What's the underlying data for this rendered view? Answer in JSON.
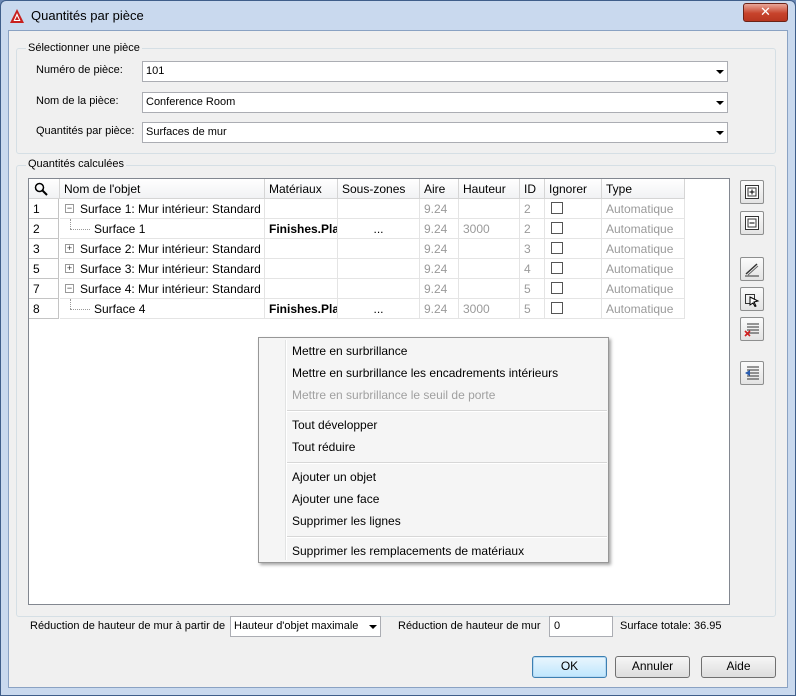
{
  "window": {
    "title": "Quantités par pièce",
    "close_glyph": "✕"
  },
  "select_group": {
    "legend": "Sélectionner une pièce",
    "room_number_label": "Numéro de pièce:",
    "room_number_value": "101",
    "room_name_label": "Nom de la pièce:",
    "room_name_value": "Conference Room",
    "quantities_label": "Quantités par pièce:",
    "quantities_value": "Surfaces de mur"
  },
  "calc_group": {
    "legend": "Quantités calculées",
    "columns": [
      "Nom de l'objet",
      "Matériaux",
      "Sous-zones",
      "Aire",
      "Hauteur",
      "ID",
      "Ignorer",
      "Type"
    ],
    "rows": [
      {
        "num": "1",
        "name": "Surface 1: Mur intérieur: Standard",
        "material": "",
        "subzones": "",
        "area": "9.24",
        "height": "",
        "id": "2",
        "type": "Automatique",
        "level": 0,
        "toggle": "−"
      },
      {
        "num": "2",
        "name": "Surface 1",
        "material": "Finishes.Plas",
        "subzones": "...",
        "area": "9.24",
        "height": "3000",
        "id": "2",
        "type": "Automatique",
        "level": 1,
        "toggle": ""
      },
      {
        "num": "3",
        "name": "Surface 2: Mur intérieur: Standard",
        "material": "",
        "subzones": "",
        "area": "9.24",
        "height": "",
        "id": "3",
        "type": "Automatique",
        "level": 0,
        "toggle": "+"
      },
      {
        "num": "5",
        "name": "Surface 3: Mur intérieur: Standard",
        "material": "",
        "subzones": "",
        "area": "9.24",
        "height": "",
        "id": "4",
        "type": "Automatique",
        "level": 0,
        "toggle": "+"
      },
      {
        "num": "7",
        "name": "Surface 4: Mur intérieur: Standard",
        "material": "",
        "subzones": "",
        "area": "9.24",
        "height": "",
        "id": "5",
        "type": "Automatique",
        "level": 0,
        "toggle": "−"
      },
      {
        "num": "8",
        "name": "Surface 4",
        "material": "Finishes.Plas",
        "subzones": "...",
        "area": "9.24",
        "height": "3000",
        "id": "5",
        "type": "Automatique",
        "level": 1,
        "toggle": ""
      }
    ]
  },
  "context_menu": {
    "items": [
      {
        "label": "Mettre en surbrillance",
        "disabled": false
      },
      {
        "label": "Mettre en surbrillance les encadrements intérieurs",
        "disabled": false
      },
      {
        "label": "Mettre en surbrillance le seuil de porte",
        "disabled": true
      },
      {
        "label": "Tout développer",
        "disabled": false
      },
      {
        "label": "Tout réduire",
        "disabled": false
      },
      {
        "label": "Ajouter un objet",
        "disabled": false
      },
      {
        "label": "Ajouter une face",
        "disabled": false
      },
      {
        "label": "Supprimer les lignes",
        "disabled": false
      },
      {
        "label": "Supprimer les remplacements de matériaux",
        "disabled": false
      }
    ]
  },
  "bottom": {
    "reduction_from_label": "Réduction de hauteur de mur à partir de",
    "reduction_from_value": "Hauteur d'objet maximale",
    "reduction_label": "Réduction de hauteur de mur",
    "reduction_value": "0",
    "total_surface": "Surface totale: 36.95"
  },
  "buttons": {
    "ok": "OK",
    "cancel": "Annuler",
    "help": "Aide"
  },
  "colors": {
    "accent": "#3c7fb1",
    "gray_text": "#9a9a9a"
  }
}
